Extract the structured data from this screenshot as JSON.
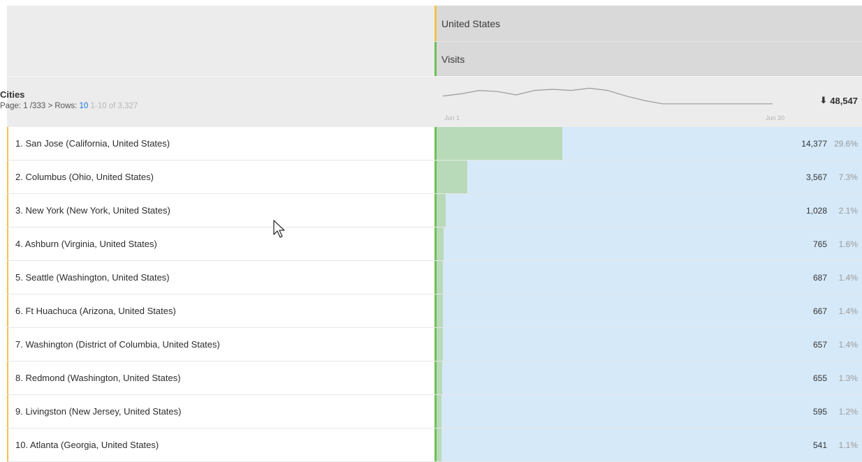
{
  "header": {
    "segment": "United States",
    "metric": "Visits"
  },
  "dimension": {
    "title": "Cities",
    "page_label": "Page:",
    "page_value": "1 /333",
    "page_next": ">",
    "rows_label": "Rows:",
    "rows_value": "10",
    "range": "1-10 of 3,327"
  },
  "sparkline": {
    "start_label": "Jun 1",
    "end_label": "Jun 30",
    "points": [
      0.55,
      0.45,
      0.3,
      0.35,
      0.5,
      0.3,
      0.25,
      0.3,
      0.2,
      0.3,
      0.55,
      0.75,
      0.9,
      0.9,
      0.9,
      0.9,
      0.9,
      0.9,
      0.9
    ]
  },
  "total": {
    "icon": "sort-down-arrow-icon",
    "value": "48,547"
  },
  "rows": [
    {
      "label": "1. San Jose (California, United States)",
      "count": "14,377",
      "pct": "29.6%",
      "share": 0.296
    },
    {
      "label": "2. Columbus (Ohio, United States)",
      "count": "3,567",
      "pct": "7.3%",
      "share": 0.073
    },
    {
      "label": "3. New York (New York, United States)",
      "count": "1,028",
      "pct": "2.1%",
      "share": 0.021
    },
    {
      "label": "4. Ashburn (Virginia, United States)",
      "count": "765",
      "pct": "1.6%",
      "share": 0.016
    },
    {
      "label": "5. Seattle (Washington, United States)",
      "count": "687",
      "pct": "1.4%",
      "share": 0.014
    },
    {
      "label": "6. Ft Huachuca (Arizona, United States)",
      "count": "667",
      "pct": "1.4%",
      "share": 0.014
    },
    {
      "label": "7. Washington (District of Columbia, United States)",
      "count": "657",
      "pct": "1.4%",
      "share": 0.014
    },
    {
      "label": "8. Redmond (Washington, United States)",
      "count": "655",
      "pct": "1.3%",
      "share": 0.013
    },
    {
      "label": "9. Livingston (New Jersey, United States)",
      "count": "595",
      "pct": "1.2%",
      "share": 0.012
    },
    {
      "label": "10. Atlanta (Georgia, United States)",
      "count": "541",
      "pct": "1.1%",
      "share": 0.011
    }
  ],
  "colors": {
    "segment_accent": "#f2c24a",
    "metric_accent": "#6fbf5a",
    "bar_fill": "#b9dab9",
    "bar_track": "#d6e9f8",
    "link": "#1473e6"
  }
}
